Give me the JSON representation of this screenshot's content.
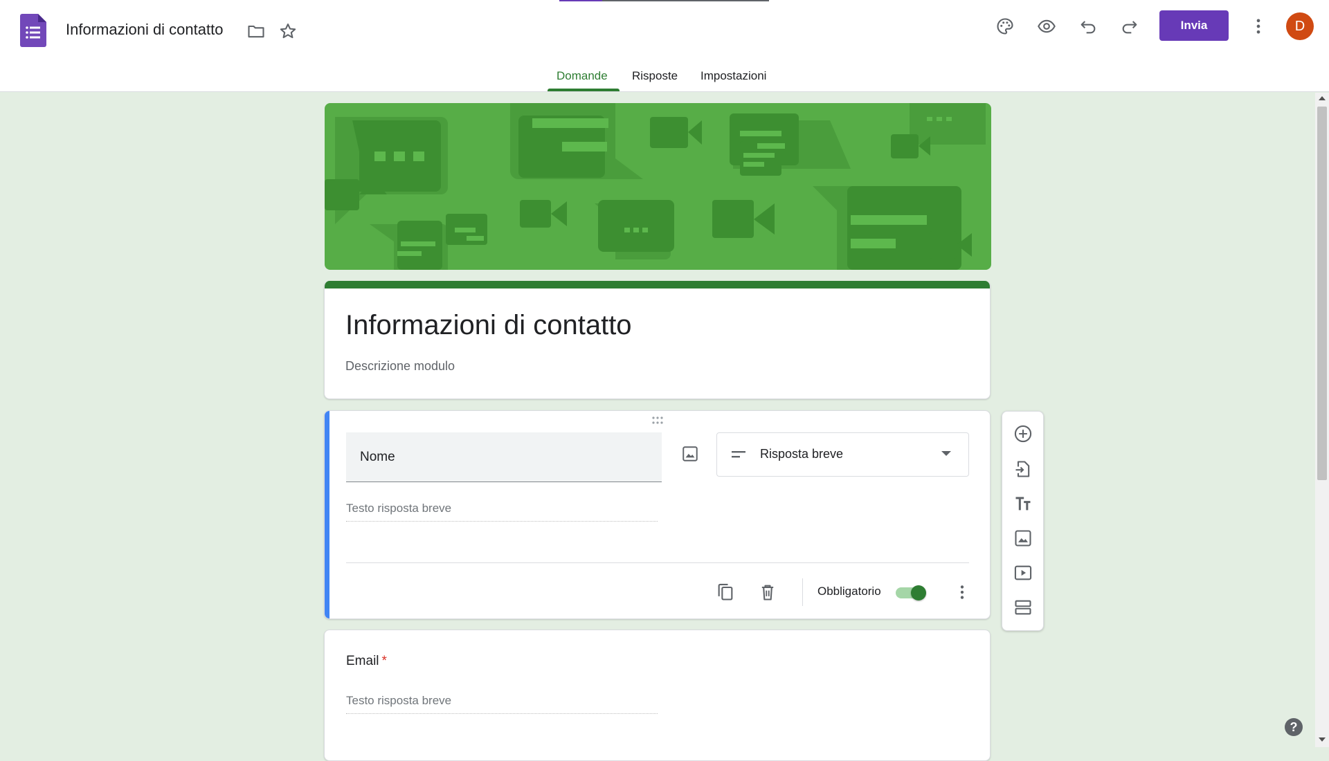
{
  "app": {
    "document_title": "Informazioni di contatto",
    "send_label": "Invia",
    "avatar_letter": "D",
    "icons": [
      "folder-icon",
      "star-icon",
      "palette-icon",
      "preview-icon",
      "undo-icon",
      "redo-icon",
      "more-vert-icon"
    ]
  },
  "tabs": [
    {
      "label": "Domande",
      "active": true
    },
    {
      "label": "Risposte",
      "active": false
    },
    {
      "label": "Impostazioni",
      "active": false
    }
  ],
  "form": {
    "title": "Informazioni di contatto",
    "description_placeholder": "Descrizione modulo"
  },
  "active_question": {
    "title": "Nome",
    "type_label": "Risposta breve",
    "answer_placeholder": "Testo risposta breve",
    "required_label": "Obbligatorio",
    "required": true
  },
  "next_question": {
    "title": "Email",
    "required_mark": "*",
    "answer_placeholder": "Testo risposta breve"
  },
  "side_toolbar": [
    "add-question-icon",
    "import-questions-icon",
    "add-title-icon",
    "add-image-icon",
    "add-video-icon",
    "add-section-icon"
  ],
  "help_label": "?",
  "colors": {
    "accent_purple": "#673ab7",
    "theme_green": "#2e7d32",
    "banner_green": "#57ad47",
    "background": "#e3eee2",
    "question_focus_blue": "#4285f4",
    "avatar": "#d04a12"
  }
}
